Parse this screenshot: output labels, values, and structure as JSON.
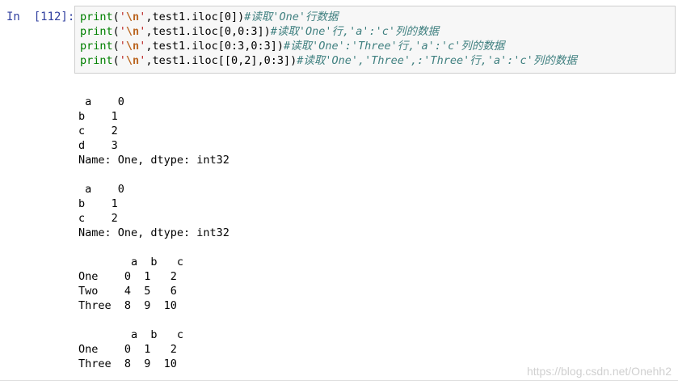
{
  "prompt": "In  [112]:",
  "code_lines": [
    {
      "fn": "print",
      "open": "(",
      "q1": "'",
      "esc": "\\n",
      "q2": "'",
      "mid": ",test1.iloc[0])",
      "comment": "#读取'One'行数据"
    },
    {
      "fn": "print",
      "open": "(",
      "q1": "'",
      "esc": "\\n",
      "q2": "'",
      "mid": ",test1.iloc[0,0:3])",
      "comment": "#读取'One'行,'a':'c'列的数据"
    },
    {
      "fn": "print",
      "open": "(",
      "q1": "'",
      "esc": "\\n",
      "q2": "'",
      "mid": ",test1.iloc[0:3,0:3])",
      "comment": "#读取'One':'Three'行,'a':'c'列的数据"
    },
    {
      "fn": "print",
      "open": "(",
      "q1": "'",
      "esc": "\\n",
      "q2": "'",
      "mid": ",test1.iloc[[0,2],0:3])",
      "comment": "#读取'One','Three',:'Three'行,'a':'c'列的数据"
    }
  ],
  "output_lines": [
    " a    0",
    "b    1",
    "c    2",
    "d    3",
    "Name: One, dtype: int32",
    "",
    " a    0",
    "b    1",
    "c    2",
    "Name: One, dtype: int32",
    "",
    "        a  b   c",
    "One    0  1   2",
    "Two    4  5   6",
    "Three  8  9  10",
    "",
    "        a  b   c",
    "One    0  1   2",
    "Three  8  9  10"
  ],
  "watermark": "https://blog.csdn.net/Onehh2"
}
